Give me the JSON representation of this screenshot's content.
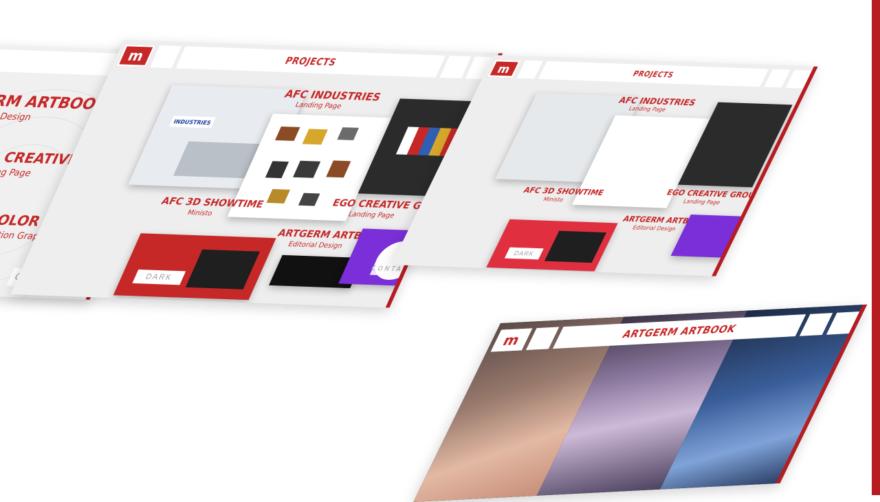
{
  "colors": {
    "brand_red": "#c62828",
    "dark_red": "#b71c20",
    "purple": "#7b2fd8",
    "panel_bg": "#eeeeee",
    "dark_card": "#2b2b2b"
  },
  "brand": {
    "logo_letter": "m"
  },
  "mockup1": {
    "projects": [
      {
        "title": "GERM ARTBOOK",
        "subtitle": "itorial Design"
      },
      {
        "title": "EGO CREATIVE GROUP",
        "subtitle": "Landing Page"
      },
      {
        "title": "COLOR SHINE",
        "subtitle": "Motion Graphics"
      }
    ],
    "contact_label": "CONTACT"
  },
  "mockup2": {
    "header_title": "PROJECTS",
    "projects": [
      {
        "title": "AFC INDUSTRIES",
        "subtitle": "Landing Page"
      },
      {
        "title": "EGO CREATIVE GROUP",
        "subtitle": "Landing Page"
      },
      {
        "title": "AFC 3D SHOWTIME",
        "subtitle": "Ministo"
      },
      {
        "title": "ARTGERM ARTBOOK",
        "subtitle": "Editorial Design"
      }
    ],
    "card_labels": {
      "industries_logo": "INDUSTRIES",
      "dark_theme": "DARK"
    },
    "contact_label": "CONTACT"
  },
  "mockup3": {
    "header_title": "PROJECTS",
    "projects": [
      {
        "title": "AFC INDUSTRIES",
        "subtitle": "Landing Page"
      },
      {
        "title": "EGO CREATIVE GROUP",
        "subtitle": "Landing Page"
      },
      {
        "title": "AFC 3D SHOWTIME",
        "subtitle": "Ministo"
      },
      {
        "title": "ARTGERM ARTBOOK",
        "subtitle": "Editorial Design"
      }
    ],
    "card_labels": {
      "dark_theme": "DARK"
    }
  },
  "mockup4": {
    "header_title": "ARTGERM ARTBOOK"
  }
}
